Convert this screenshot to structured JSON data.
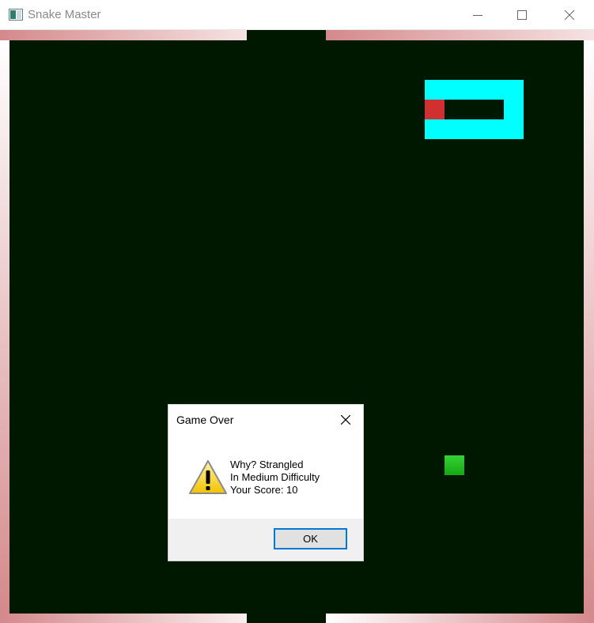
{
  "window": {
    "title": "Snake Master",
    "icon": "app-window-icon",
    "controls": [
      "minimize-icon",
      "maximize-icon",
      "close-icon"
    ]
  },
  "game": {
    "board_color": "#001800",
    "border_color": "#d4898b",
    "snake_body_color": "#00ffff",
    "snake_head_color": "#d03030",
    "food_color": "#22bb22"
  },
  "dialog": {
    "title": "Game Over",
    "message_lines": [
      "Why? Strangled",
      "In Medium Difficulty",
      "Your Score: 10"
    ],
    "icon": "warning-icon",
    "ok_label": "OK"
  }
}
